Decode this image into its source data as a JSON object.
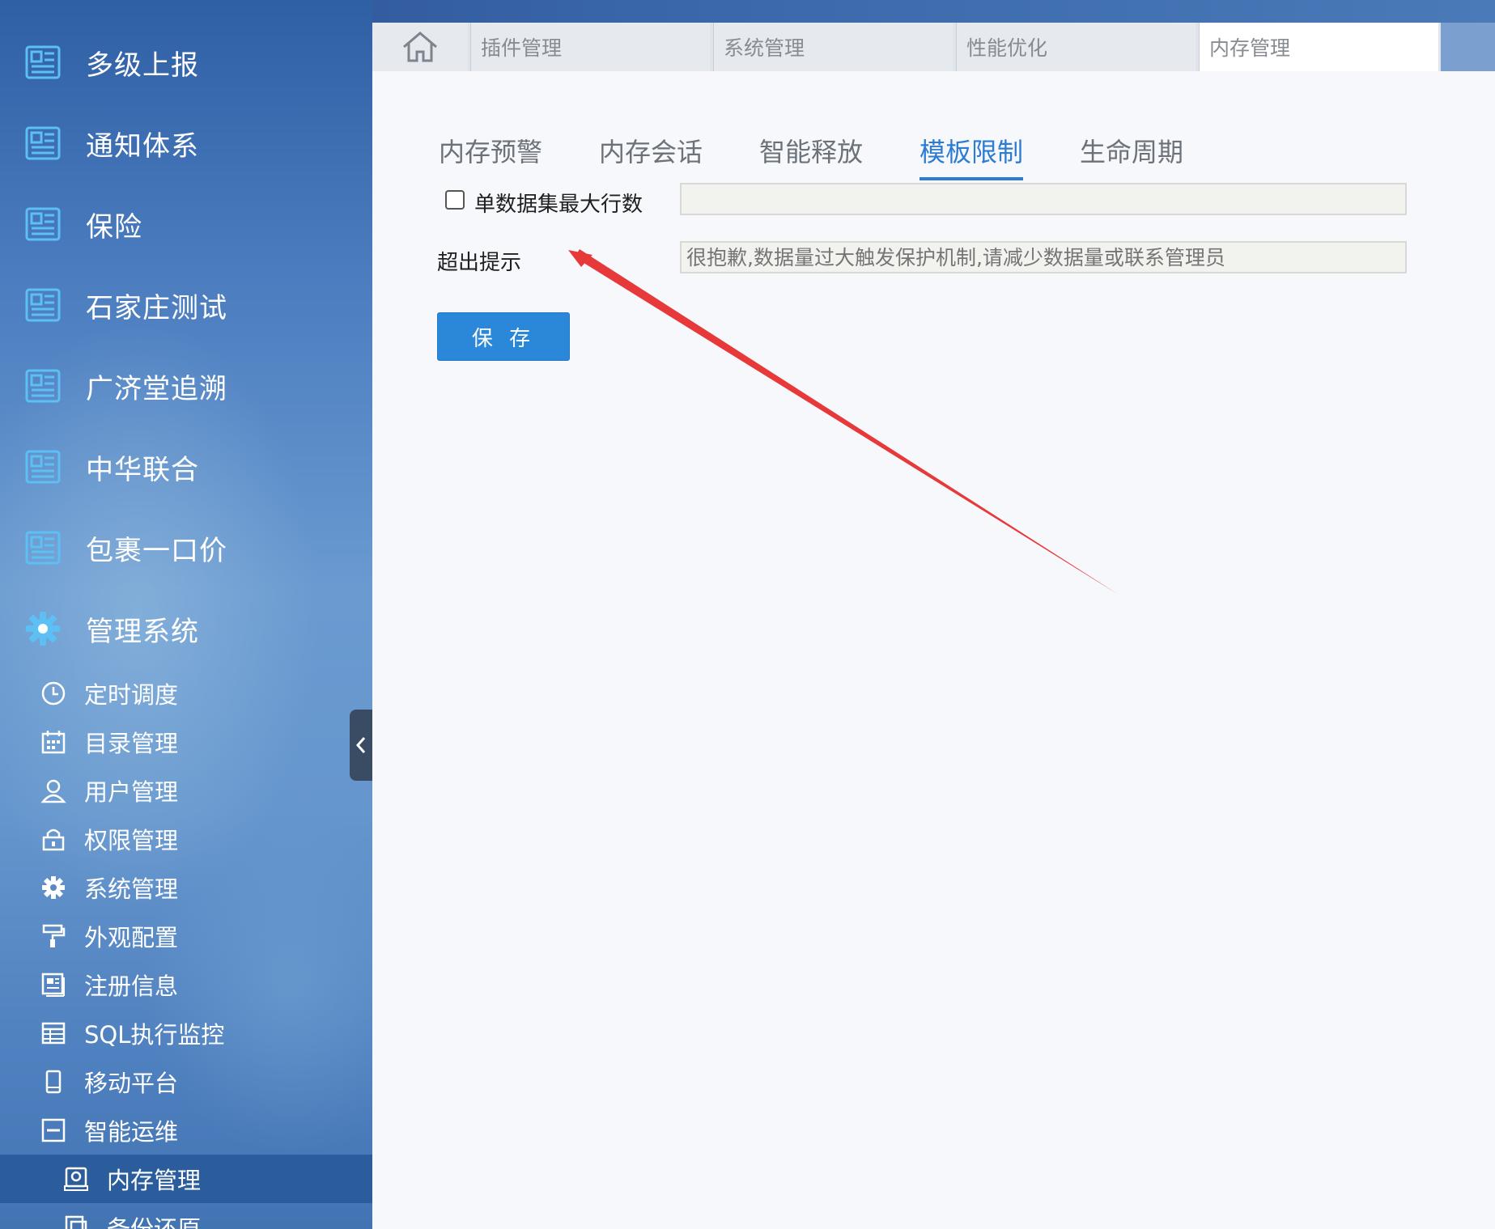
{
  "sidebar": {
    "top_items": [
      {
        "label": "多级上报",
        "icon": "newspaper-icon"
      },
      {
        "label": "通知体系",
        "icon": "newspaper-icon"
      },
      {
        "label": "保险",
        "icon": "newspaper-icon"
      },
      {
        "label": "石家庄测试",
        "icon": "newspaper-icon"
      },
      {
        "label": "广济堂追溯",
        "icon": "newspaper-icon"
      },
      {
        "label": "中华联合",
        "icon": "newspaper-icon"
      },
      {
        "label": "包裹一口价",
        "icon": "newspaper-icon"
      },
      {
        "label": "管理系统",
        "icon": "gear-icon"
      }
    ],
    "sub_items": [
      {
        "label": "定时调度",
        "icon": "clock-icon"
      },
      {
        "label": "目录管理",
        "icon": "calendar-icon"
      },
      {
        "label": "用户管理",
        "icon": "user-icon"
      },
      {
        "label": "权限管理",
        "icon": "lock-icon"
      },
      {
        "label": "系统管理",
        "icon": "gear-icon"
      },
      {
        "label": "外观配置",
        "icon": "paint-roller-icon"
      },
      {
        "label": "注册信息",
        "icon": "document-icon"
      },
      {
        "label": "SQL执行监控",
        "icon": "table-icon"
      },
      {
        "label": "移动平台",
        "icon": "mobile-icon"
      },
      {
        "label": "智能运维",
        "icon": "minus-square-icon"
      }
    ],
    "level3_items": [
      {
        "label": "内存管理",
        "icon": "memory-icon",
        "active": true
      },
      {
        "label": "备份还原",
        "icon": "backup-icon"
      }
    ],
    "collapse_icon": "chevron-left-icon"
  },
  "tabs": {
    "home_icon": "home-icon",
    "items": [
      {
        "label": "插件管理"
      },
      {
        "label": "系统管理"
      },
      {
        "label": "性能优化"
      },
      {
        "label": "内存管理",
        "active": true
      }
    ]
  },
  "subtabs": [
    {
      "label": "内存预警"
    },
    {
      "label": "内存会话"
    },
    {
      "label": "智能释放"
    },
    {
      "label": "模板限制",
      "active": true
    },
    {
      "label": "生命周期"
    }
  ],
  "form": {
    "max_rows_label": "单数据集最大行数",
    "max_rows_value": "",
    "max_rows_checked": false,
    "overflow_label": "超出提示",
    "overflow_placeholder": "很抱歉,数据量过大触发保护机制,请减少数据量或联系管理员",
    "save_label": "保 存"
  },
  "colors": {
    "accent": "#2d7cd2",
    "button": "#2b88d8",
    "annotation_arrow": "#e8393a",
    "sidebar_active": "#2b5c9b"
  }
}
